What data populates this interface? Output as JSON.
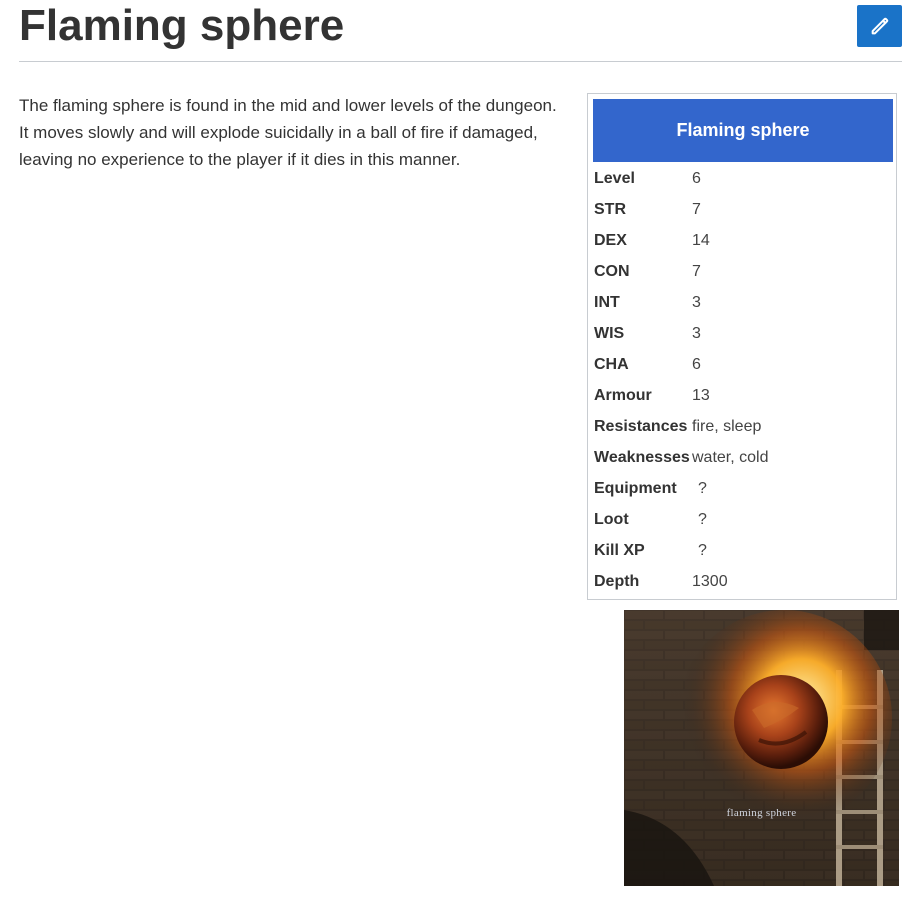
{
  "page": {
    "title": "Flaming sphere",
    "intro": "The flaming sphere is found in the mid and lower levels of the dungeon. It moves slowly and will explode suicidally in a ball of fire if damaged, leaving no experience to the player if it dies in this manner."
  },
  "toolbar": {
    "edit_icon": "pencil-icon",
    "accent_color": "#1a73c8"
  },
  "infobox": {
    "title": "Flaming sphere",
    "header_color": "#3366cc",
    "rows": [
      {
        "label": "Level",
        "value": "6"
      },
      {
        "label": "STR",
        "value": "7"
      },
      {
        "label": "DEX",
        "value": "14"
      },
      {
        "label": "CON",
        "value": "7"
      },
      {
        "label": "INT",
        "value": "3"
      },
      {
        "label": "WIS",
        "value": "3"
      },
      {
        "label": "CHA",
        "value": "6"
      },
      {
        "label": "Armour",
        "value": "13"
      },
      {
        "label": "Resistances",
        "value": "fire, sleep"
      },
      {
        "label": "Weaknesses",
        "value": "water, cold"
      },
      {
        "label": "Equipment",
        "value": "?"
      },
      {
        "label": "Loot",
        "value": "?"
      },
      {
        "label": "Kill XP",
        "value": "?"
      },
      {
        "label": "Depth",
        "value": "1300"
      }
    ]
  },
  "image": {
    "caption": "flaming sphere"
  }
}
